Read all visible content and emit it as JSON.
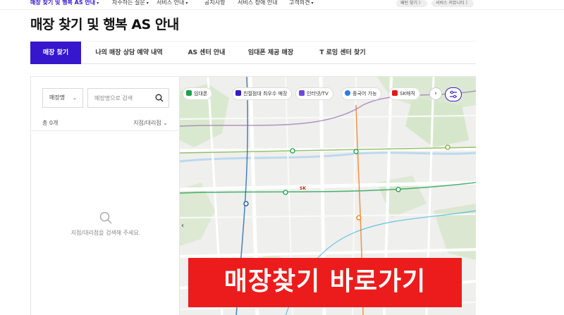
{
  "nav": {
    "items": [
      {
        "label": "매장 찾기 및 행복 AS 안내",
        "active": true,
        "dropdown": true
      },
      {
        "label": "자주하는 질문",
        "dropdown": true
      },
      {
        "label": "서비스 안내",
        "dropdown": true
      },
      {
        "label": "공지사항",
        "dropdown": false
      },
      {
        "label": "서비스 장애 안내",
        "dropdown": false
      },
      {
        "label": "고객의견",
        "dropdown": true
      }
    ],
    "buttons": [
      "패턴 찾기 〉",
      "서비스 커뮤니티 〉"
    ]
  },
  "page_title": "매장 찾기 및 행복 AS 안내",
  "tabs": [
    {
      "label": "매장 찾기",
      "active": true
    },
    {
      "label": "나의 매장 상담 예약 내역"
    },
    {
      "label": "AS 센터 안내"
    },
    {
      "label": "임대폰 제공 매장"
    },
    {
      "label": "T 로밍 센터 찾기"
    }
  ],
  "search_panel": {
    "select_value": "매장명",
    "search_placeholder": "매장명으로 검색",
    "count_label": "총 0개",
    "filter_label": "지점/대리점",
    "empty_message": "지점/대리점을 검색해 주세요."
  },
  "map": {
    "chips": [
      "임대폰",
      "친절점대 최우수 매장",
      "인터넷/TV",
      "중국어 가능",
      "SK매직"
    ],
    "sk_marker": "SK"
  },
  "banner": {
    "text": "매장찾기 바로가기",
    "color": "#ec1c1c"
  },
  "colors": {
    "accent": "#3617ce",
    "banner": "#ec1c1c"
  }
}
